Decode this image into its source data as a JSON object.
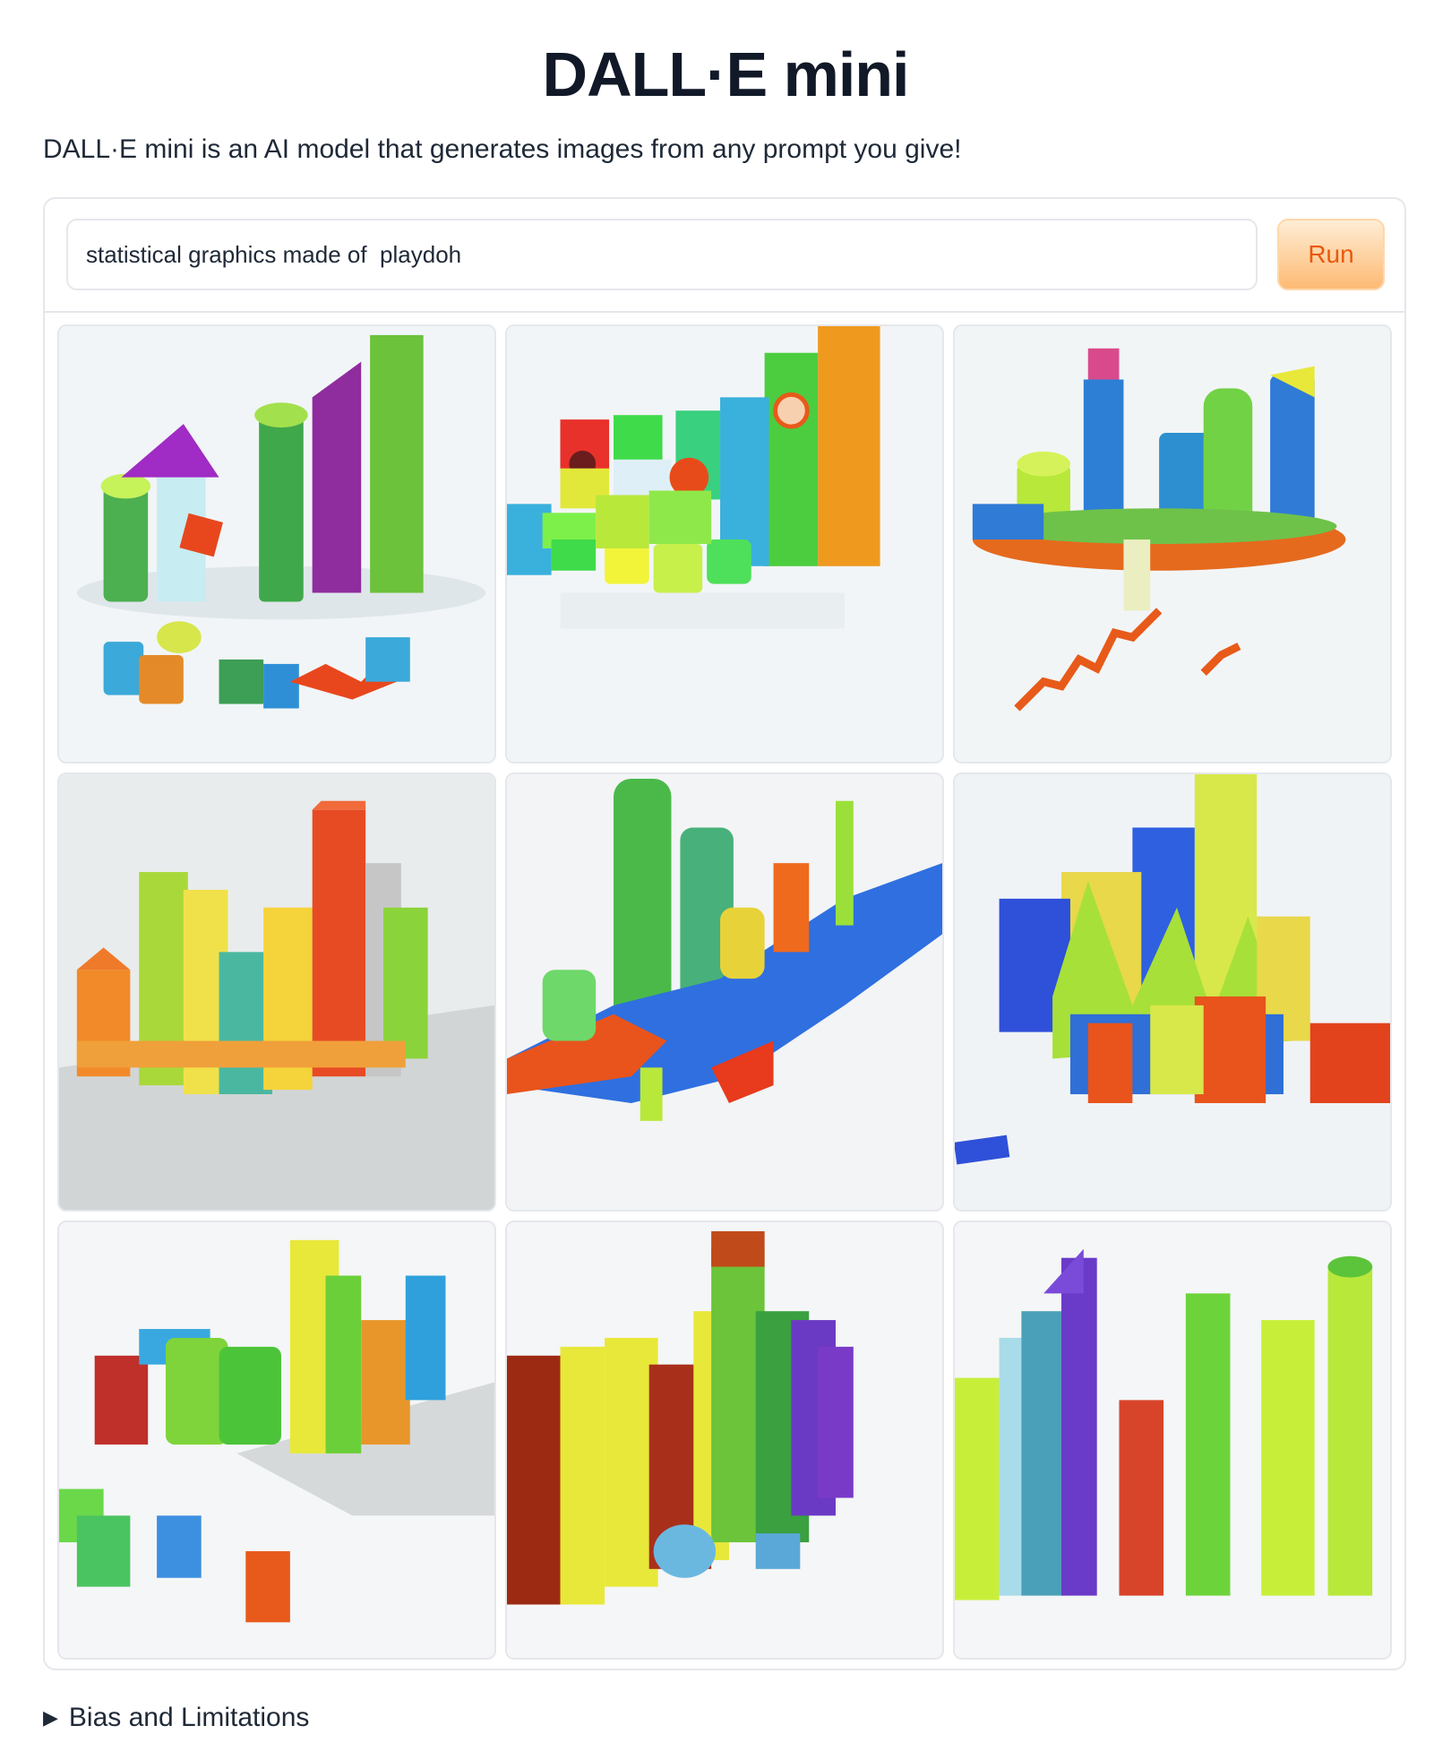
{
  "header": {
    "title": "DALL·E mini",
    "description": "DALL·E mini is an AI model that generates images from any prompt you give!"
  },
  "prompt": {
    "value": "statistical graphics made of  playdoh",
    "run_label": "Run"
  },
  "results": {
    "count": 9
  },
  "footer": {
    "bias_label": "Bias and Limitations"
  },
  "colors": {
    "accent": "#f97316",
    "border": "#e5e7eb",
    "text": "#1f2937"
  }
}
